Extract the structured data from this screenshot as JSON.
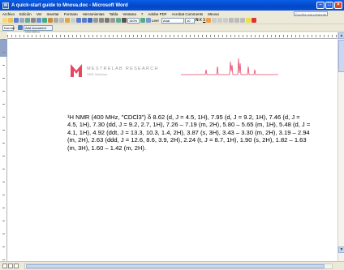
{
  "window": {
    "title": "A quick-start guide to Mnova.doc - Microsoft Word"
  },
  "menu": {
    "items": [
      "Archivo",
      "Edición",
      "Ver",
      "Insertar",
      "Formato",
      "Herramientas",
      "Tabla",
      "Ventana",
      "?",
      "Adobe PDF",
      "Acrobat Comments",
      "Mnova"
    ],
    "help_placeholder": "Escriba una pregunta"
  },
  "toolbar": {
    "zoom": "140%",
    "read_label": "Leer",
    "font": "Arial",
    "size": "10",
    "style": "Normal",
    "task_pane_label": "Add document simulation"
  },
  "logo": {
    "brand": "MESTRELAB RESEARCH",
    "tagline": "NMR Solutions"
  },
  "document": {
    "nmr_text": "¹H NMR (400 MHz, \"CDCl3\") δ 8.62 (d, J = 4.5, 1H), 7.95 (d, J = 9.2, 1H), 7.46 (d, J = 4.5, 1H), 7.30 (dd, J = 9.2, 2.7, 1H), 7.26 – 7.19 (m, 2H), 5.80 – 5.65 (m, 1H), 5.48 (d, J = 4.1, 1H), 4.92 (ddt, J = 13.3, 10.3, 1.4, 2H), 3.87 (s, 3H), 3.43 – 3.30 (m, 2H), 3.19 – 2.94 (m, 2H), 2.63 (ddd, J = 12.6, 8.6, 3.9, 2H), 2.24 (t, J = 8.7, 1H), 1.90 (s, 2H), 1.82 – 1.63 (m, 3H), 1.60 – 1.42 (m, 2H)."
  },
  "colors": {
    "titlebar": "#0a5ee6",
    "spectrum": "#e54a6a",
    "logo": "#e8455f"
  }
}
